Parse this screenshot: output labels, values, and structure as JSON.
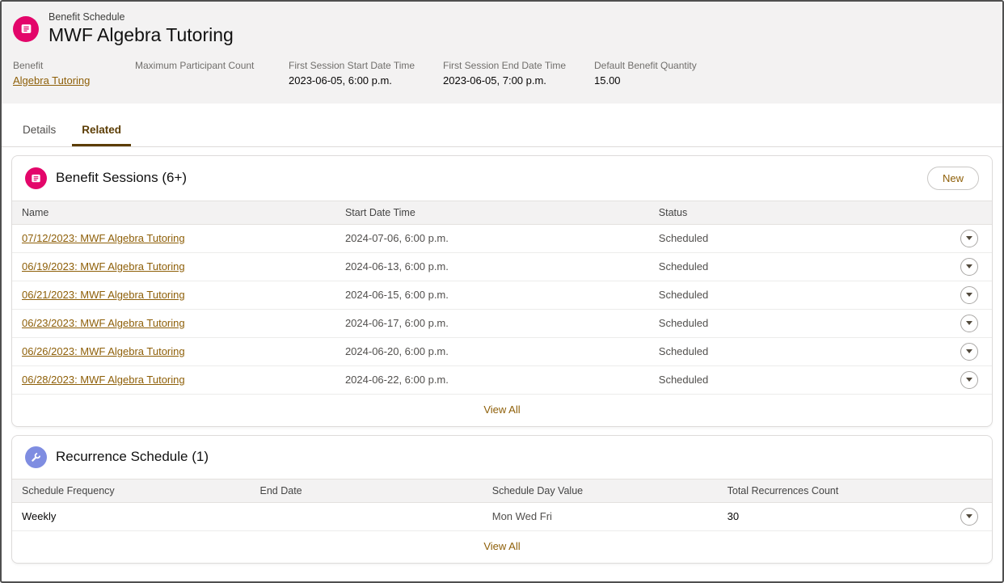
{
  "colors": {
    "brand_link": "#8e5f08",
    "tab_active": "#5c3d05",
    "benefit_icon_pink": "#e3066a",
    "recurrence_icon_purple": "#7f8de1",
    "header_bg": "#f3f2f2"
  },
  "record_header": {
    "entity_label": "Benefit Schedule",
    "title": "MWF Algebra Tutoring",
    "fields": [
      {
        "label": "Benefit",
        "value": "Algebra Tutoring"
      },
      {
        "label": "Maximum Participant Count",
        "value": ""
      },
      {
        "label": "First Session Start Date Time",
        "value": "2023-06-05, 6:00 p.m."
      },
      {
        "label": "First Session End Date Time",
        "value": "2023-06-05, 7:00 p.m."
      },
      {
        "label": "Default Benefit Quantity",
        "value": "15.00"
      }
    ]
  },
  "tabs": {
    "details": "Details",
    "related": "Related"
  },
  "benefit_sessions": {
    "title": "Benefit Sessions (6+)",
    "new_button": "New",
    "columns": {
      "name": "Name",
      "start": "Start Date Time",
      "status": "Status"
    },
    "rows": [
      {
        "name": "07/12/2023: MWF Algebra Tutoring",
        "start": "2024-07-06, 6:00 p.m.",
        "status": "Scheduled"
      },
      {
        "name": "06/19/2023: MWF Algebra Tutoring",
        "start": "2024-06-13, 6:00 p.m.",
        "status": "Scheduled"
      },
      {
        "name": "06/21/2023: MWF Algebra Tutoring",
        "start": "2024-06-15, 6:00 p.m.",
        "status": "Scheduled"
      },
      {
        "name": "06/23/2023: MWF Algebra Tutoring",
        "start": "2024-06-17, 6:00 p.m.",
        "status": "Scheduled"
      },
      {
        "name": "06/26/2023: MWF Algebra Tutoring",
        "start": "2024-06-20, 6:00 p.m.",
        "status": "Scheduled"
      },
      {
        "name": "06/28/2023: MWF Algebra Tutoring",
        "start": "2024-06-22, 6:00 p.m.",
        "status": "Scheduled"
      }
    ],
    "view_all": "View All"
  },
  "recurrence_schedule": {
    "title": "Recurrence Schedule (1)",
    "columns": {
      "frequency": "Schedule Frequency",
      "end_date": "End Date",
      "day_value": "Schedule Day Value",
      "count": "Total Recurrences Count"
    },
    "rows": [
      {
        "frequency": "Weekly",
        "end_date": "",
        "day_value": "Mon Wed Fri",
        "count": "30"
      }
    ],
    "view_all": "View All"
  }
}
